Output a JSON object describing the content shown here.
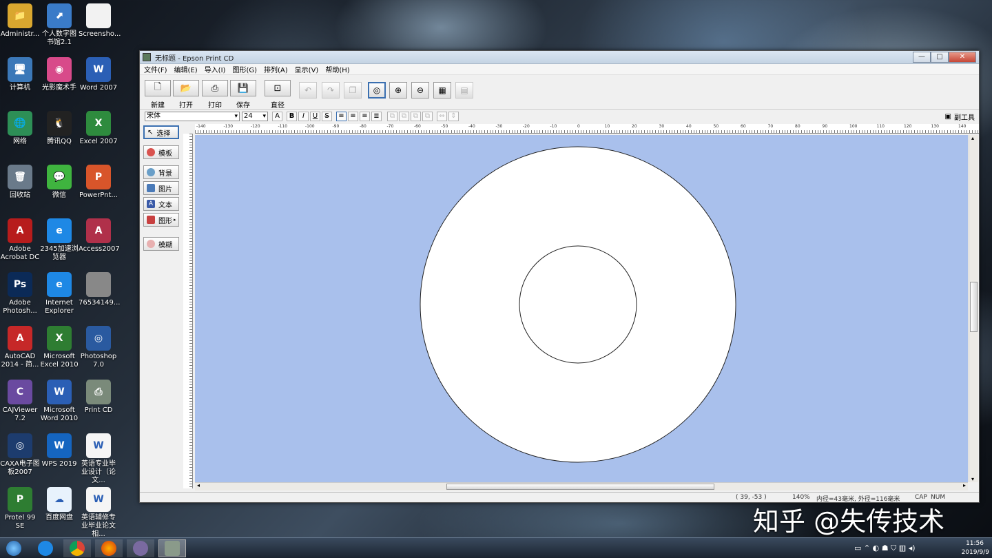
{
  "desktop": {
    "icons": [
      {
        "label": "Administr...",
        "glyph": "📁",
        "color": "#d9a72f"
      },
      {
        "label": "个人数字图书馆2.1",
        "glyph": "⬈",
        "color": "#3a7bc8"
      },
      {
        "label": "Screensho...",
        "glyph": "",
        "color": "#f2f2f2"
      },
      {
        "label": "计算机",
        "glyph": "🖥",
        "color": "#3b78b8"
      },
      {
        "label": "光影魔术手",
        "glyph": "◉",
        "color": "#d84a8a"
      },
      {
        "label": "Word 2007",
        "glyph": "W",
        "color": "#2b5fb5"
      },
      {
        "label": "网络",
        "glyph": "🌐",
        "color": "#2d8f56"
      },
      {
        "label": "腾讯QQ",
        "glyph": "🐧",
        "color": "#222"
      },
      {
        "label": "Excel 2007",
        "glyph": "X",
        "color": "#2e8b3e"
      },
      {
        "label": "回收站",
        "glyph": "🗑",
        "color": "#6a7a8a"
      },
      {
        "label": "微信",
        "glyph": "💬",
        "color": "#3fb43f"
      },
      {
        "label": "PowerPnt...",
        "glyph": "P",
        "color": "#d8552a"
      },
      {
        "label": "Adobe Acrobat DC",
        "glyph": "A",
        "color": "#b71c1c"
      },
      {
        "label": "2345加速浏览器",
        "glyph": "e",
        "color": "#1e88e5"
      },
      {
        "label": "Access2007",
        "glyph": "A",
        "color": "#b0304a"
      },
      {
        "label": "Adobe Photosh...",
        "glyph": "Ps",
        "color": "#0b2a57"
      },
      {
        "label": "Internet Explorer",
        "glyph": "e",
        "color": "#1e88e5"
      },
      {
        "label": "76534149...",
        "glyph": "",
        "color": "#888"
      },
      {
        "label": "AutoCAD 2014 - 简...",
        "glyph": "A",
        "color": "#c62828"
      },
      {
        "label": "Microsoft Excel 2010",
        "glyph": "X",
        "color": "#2e7d32"
      },
      {
        "label": "Photoshop 7.0",
        "glyph": "◎",
        "color": "#2a5aa0"
      },
      {
        "label": "CAJViewer 7.2",
        "glyph": "C",
        "color": "#6a4aa0"
      },
      {
        "label": "Microsoft Word 2010",
        "glyph": "W",
        "color": "#2b5fb5"
      },
      {
        "label": "Print CD",
        "glyph": "⎙",
        "color": "#7a8a7a"
      },
      {
        "label": "CAXA电子图板2007",
        "glyph": "◎",
        "color": "#1d3c6e"
      },
      {
        "label": "WPS 2019",
        "glyph": "W",
        "color": "#1565c0"
      },
      {
        "label": "英语专业毕业设计（论文...",
        "glyph": "W",
        "color": "#f5f5f5"
      },
      {
        "label": "Protel 99 SE",
        "glyph": "P",
        "color": "#2e7d32"
      },
      {
        "label": "百度网盘",
        "glyph": "☁",
        "color": "#e8f2fc"
      },
      {
        "label": "英语辅修专业毕业论文相...",
        "glyph": "W",
        "color": "#f5f5f5"
      }
    ]
  },
  "window": {
    "title": "无标题 - Epson Print CD",
    "controls": {
      "minimize": "—",
      "maximize": "□",
      "close": "✕"
    },
    "menu": [
      "文件(F)",
      "编辑(E)",
      "导入(I)",
      "图形(G)",
      "排列(A)",
      "显示(V)",
      "帮助(H)"
    ],
    "toolbar": [
      {
        "label": "新建",
        "glyph": "🗋"
      },
      {
        "label": "打开",
        "glyph": "📂"
      },
      {
        "label": "打印",
        "glyph": "⎙"
      },
      {
        "label": "保存",
        "glyph": "💾"
      },
      {
        "label": "直径",
        "glyph": "⊡"
      }
    ],
    "format": {
      "font": "宋体",
      "size": "24",
      "subtoolbar": "副工具"
    },
    "side_tools": [
      {
        "label": "选择",
        "color": "#ffffff"
      },
      {
        "label": "模板",
        "color": "#d9534f"
      },
      {
        "label": "背景",
        "color": "#6a9fc8"
      },
      {
        "label": "图片",
        "color": "#4a7ab8"
      },
      {
        "label": "文本",
        "color": "#3a5aa8"
      },
      {
        "label": "图形",
        "color": "#c84040"
      },
      {
        "label": "模糊",
        "color": "#e8b0b0"
      }
    ],
    "ruler_labels": [
      "-140",
      "-130",
      "-120",
      "-110",
      "-100",
      "-90",
      "-80",
      "-70",
      "-60",
      "-50",
      "-40",
      "-30",
      "-20",
      "-10",
      "0",
      "10",
      "20",
      "30",
      "40",
      "50",
      "60",
      "70",
      "80",
      "90",
      "100",
      "110",
      "120",
      "130",
      "140"
    ],
    "status": {
      "coords": "( 39, -53 )",
      "zoom": "140%",
      "diameters": "内径=43毫米, 外径=116毫米",
      "cap": "CAP",
      "num": "NUM"
    },
    "colors": {
      "canvas": "#a9c0ec",
      "disc": "#ffffff"
    }
  },
  "taskbar": {
    "time": "11:56",
    "date": "2019/9/9"
  },
  "watermark": "知乎 @失传技术"
}
